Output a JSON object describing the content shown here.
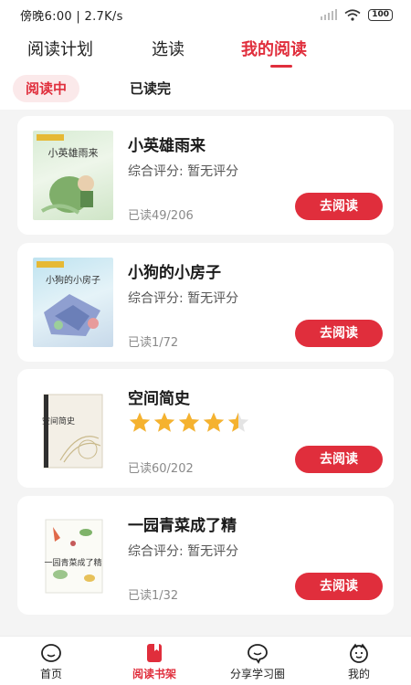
{
  "status_bar": {
    "time_speed": "傍晚6:00 | 2.7K/s",
    "battery": "100"
  },
  "top_tabs": [
    {
      "label": "阅读计划",
      "active": false
    },
    {
      "label": "选读",
      "active": false
    },
    {
      "label": "我的阅读",
      "active": true
    }
  ],
  "sub_tabs": [
    {
      "label": "阅读中",
      "active": true
    },
    {
      "label": "已读完",
      "active": false
    }
  ],
  "books": [
    {
      "title": "小英雄雨来",
      "rating_text": "综合评分: 暂无评分",
      "progress": "已读49/206",
      "button": "去阅读",
      "cover_title": "小英雄雨来"
    },
    {
      "title": "小狗的小房子",
      "rating_text": "综合评分: 暂无评分",
      "progress": "已读1/72",
      "button": "去阅读",
      "cover_title": "小狗的小房子"
    },
    {
      "title": "空间简史",
      "rating_stars": 4.5,
      "rating_max": 5,
      "progress": "已读60/202",
      "button": "去阅读",
      "cover_title": "空间简史"
    },
    {
      "title": "一园青菜成了精",
      "rating_text": "综合评分: 暂无评分",
      "progress": "已读1/32",
      "button": "去阅读",
      "cover_title": "一园青菜成了精"
    }
  ],
  "bottom_nav": [
    {
      "label": "首页",
      "icon": "home-face-icon",
      "active": false
    },
    {
      "label": "阅读书架",
      "icon": "bookshelf-icon",
      "active": true
    },
    {
      "label": "分享学习圈",
      "icon": "chat-bubble-icon",
      "active": false
    },
    {
      "label": "我的",
      "icon": "profile-face-icon",
      "active": false
    }
  ],
  "colors": {
    "accent": "#e02e3c",
    "accent_light": "#fbe9ea",
    "star": "#f5b22f",
    "background": "#f4f4f4"
  }
}
